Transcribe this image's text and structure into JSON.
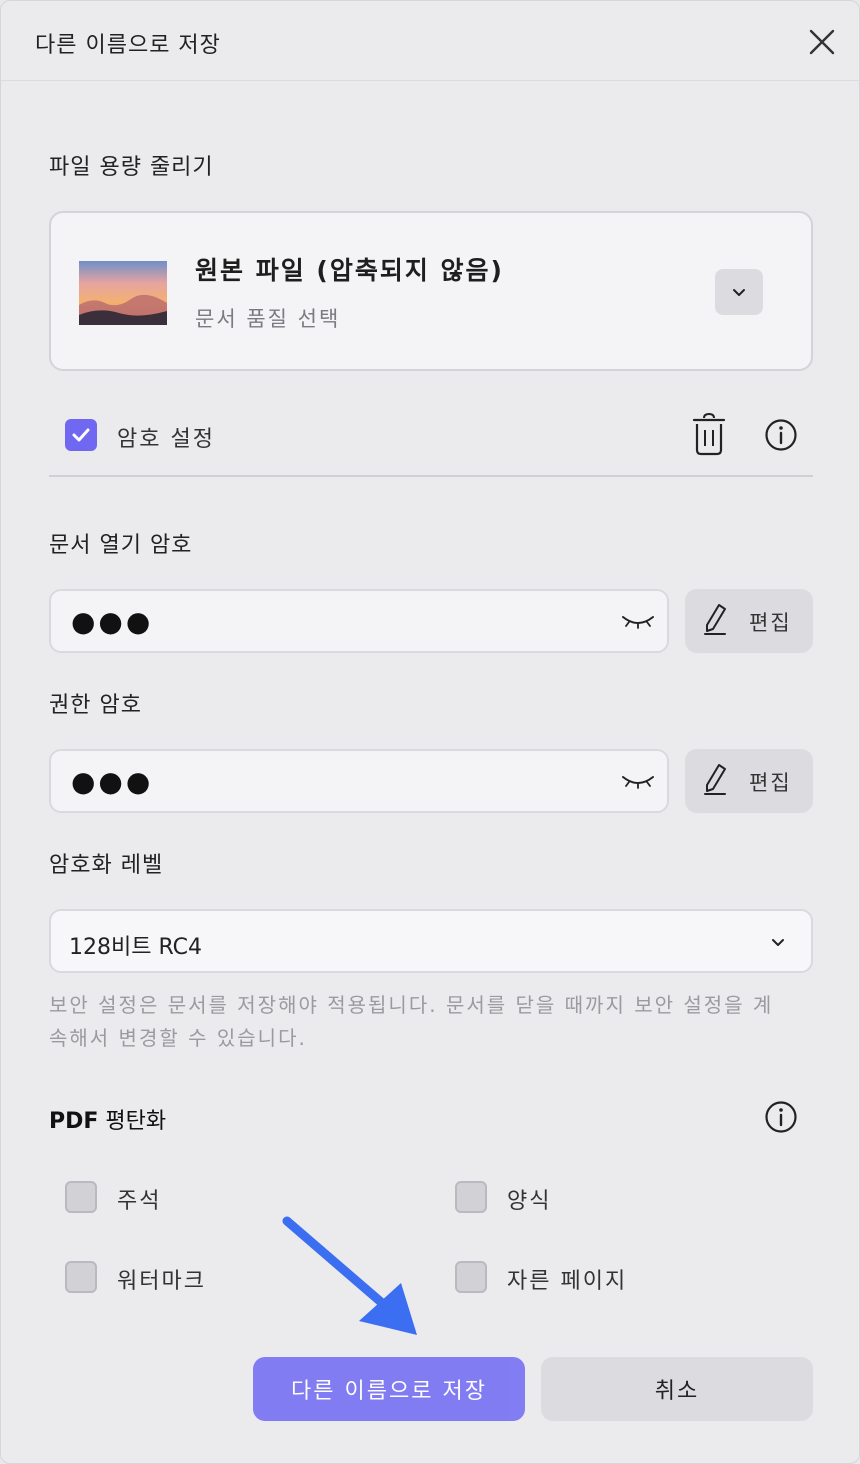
{
  "dialog": {
    "title": "다른 이름으로 저장"
  },
  "compress": {
    "label": "파일 용량 줄리기",
    "option_title": "원본 파일 (압축되지 않음)",
    "option_subtitle": "문서 품질 선택"
  },
  "password": {
    "checkbox_label": "암호 설정",
    "checked": true,
    "open_password_label": "문서 열기 암호",
    "open_password_value": "●●●",
    "permission_password_label": "권한 암호",
    "permission_password_value": "●●●",
    "edit_label": "편집",
    "encryption_label": "암호화 레벨",
    "encryption_value": "128비트 RC4",
    "note": "보안 설정은 문서를 저장해야 적용됩니다. 문서를 닫을 때까지 보안 설정을 계속해서 변경할 수 있습니다."
  },
  "flatten": {
    "label_bold": "PDF",
    "label_rest": " 평탄화",
    "options": [
      {
        "label": "주석",
        "checked": false
      },
      {
        "label": "양식",
        "checked": false
      },
      {
        "label": "워터마크",
        "checked": false
      },
      {
        "label": "자른 페이지",
        "checked": false
      }
    ]
  },
  "footer": {
    "save_label": "다른 이름으로 저장",
    "cancel_label": "취소"
  },
  "colors": {
    "accent": "#7068f0",
    "primary_button": "#7a73f3",
    "arrow": "#3b6ef0",
    "background": "#ebebee"
  },
  "icons": [
    "close-icon",
    "chevron-down-icon",
    "check-icon",
    "trash-icon",
    "info-icon",
    "eye-closed-icon",
    "pencil-icon"
  ]
}
